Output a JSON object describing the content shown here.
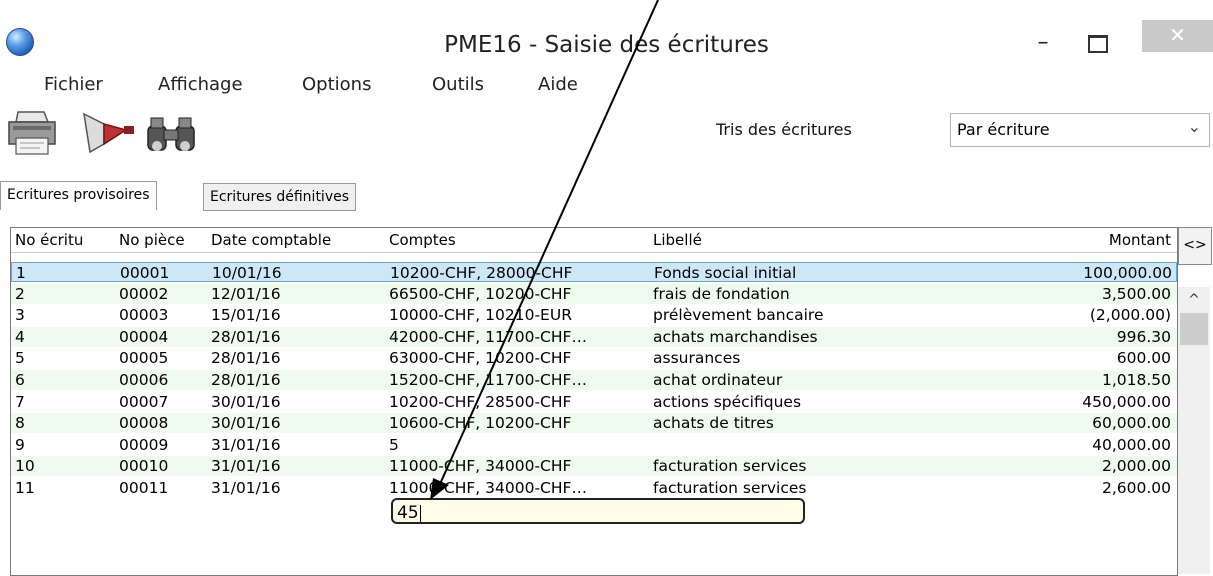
{
  "window": {
    "title": "PME16 - Saisie des écritures",
    "minimize_glyph": "–",
    "close_glyph": "✕"
  },
  "menu": [
    "Fichier",
    "Affichage",
    "Options",
    "Outils",
    "Aide"
  ],
  "toolbar": {
    "icons": [
      "printer-icon",
      "filter-funnel-icon",
      "binoculars-icon"
    ],
    "sort_label": "Tris des écritures",
    "sort_value": "Par écriture",
    "sort_arrow": "⌄"
  },
  "tabs": [
    "Ecritures provisoires",
    "Ecritures définitives"
  ],
  "table": {
    "headers": [
      "No écritu",
      "No pièce",
      "Date comptable",
      "Comptes",
      "Libellé",
      "Montant"
    ],
    "rows": [
      [
        "1",
        "00001",
        "10/01/16",
        "10200-CHF, 28000-CHF",
        "Fonds social initial",
        "100,000.00"
      ],
      [
        "2",
        "00002",
        "12/01/16",
        "66500-CHF, 10200-CHF",
        "frais de fondation",
        "3,500.00"
      ],
      [
        "3",
        "00003",
        "15/01/16",
        "10000-CHF, 10210-EUR",
        "prélèvement bancaire",
        "(2,000.00)"
      ],
      [
        "4",
        "00004",
        "28/01/16",
        "42000-CHF, 11700-CHF…",
        "achats marchandises",
        "996.30"
      ],
      [
        "5",
        "00005",
        "28/01/16",
        "63000-CHF, 10200-CHF",
        "assurances",
        "600.00"
      ],
      [
        "6",
        "00006",
        "28/01/16",
        "15200-CHF, 11700-CHF…",
        "achat ordinateur",
        "1,018.50"
      ],
      [
        "7",
        "00007",
        "30/01/16",
        "10200-CHF, 28500-CHF",
        "actions spécifiques",
        "450,000.00"
      ],
      [
        "8",
        "00008",
        "30/01/16",
        "10600-CHF, 10200-CHF",
        "achats de titres",
        "60,000.00"
      ],
      [
        "9",
        "00009",
        "31/01/16",
        "5",
        "",
        "40,000.00"
      ],
      [
        "10",
        "00010",
        "31/01/16",
        "11000-CHF, 34000-CHF",
        "facturation services",
        "2,000.00"
      ],
      [
        "11",
        "00011",
        "31/01/16",
        "11000-CHF, 34000-CHF…",
        "facturation services",
        "2,600.00"
      ]
    ]
  },
  "column_toggle": "<>",
  "scroll_up_glyph": "^",
  "inline_editor": {
    "value": "45"
  },
  "colors": {
    "selected_row": "#cde7f7",
    "alternate_row": "#eefbee",
    "editor_bg": "#fffde8"
  }
}
